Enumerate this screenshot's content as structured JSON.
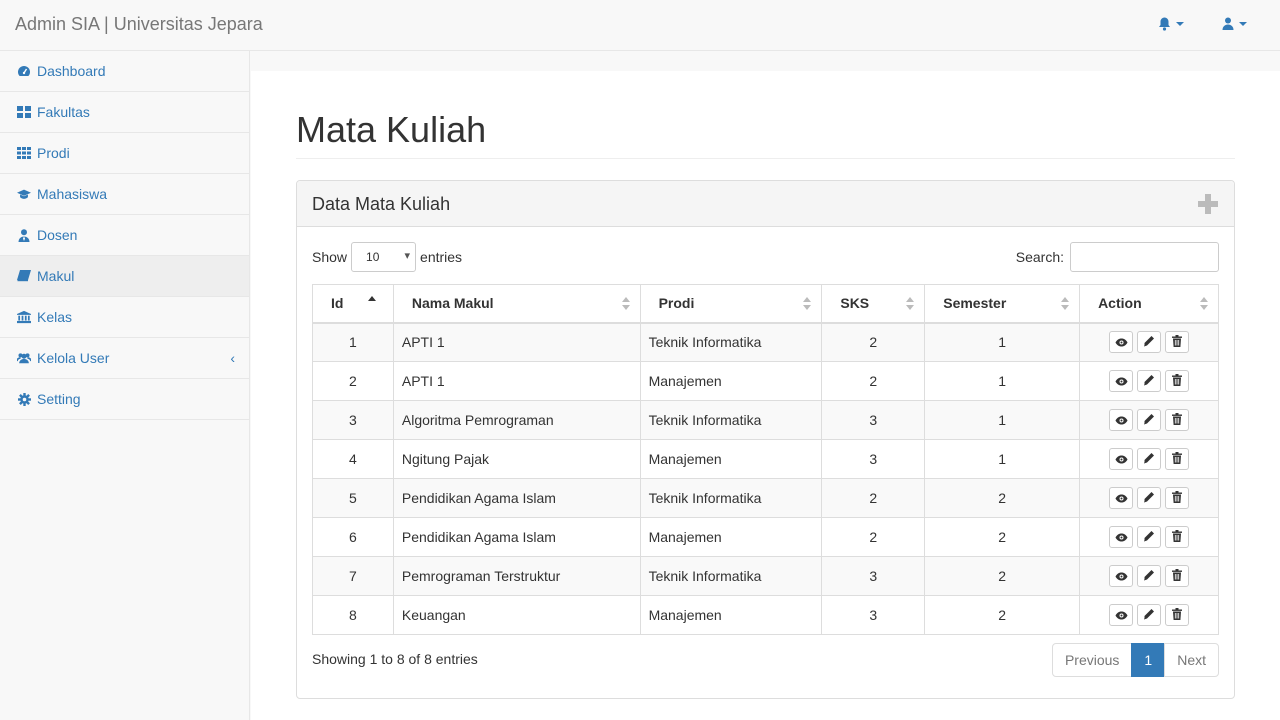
{
  "navbar": {
    "brand": "Admin SIA | Universitas Jepara",
    "icons": [
      "bell-icon",
      "user-icon"
    ]
  },
  "sidebar": {
    "items": [
      {
        "label": "Dashboard",
        "icon": "dashboard-icon"
      },
      {
        "label": "Fakultas",
        "icon": "th-large-icon"
      },
      {
        "label": "Prodi",
        "icon": "th-icon"
      },
      {
        "label": "Mahasiswa",
        "icon": "graduation-cap-icon"
      },
      {
        "label": "Dosen",
        "icon": "user-tie-icon"
      },
      {
        "label": "Makul",
        "icon": "book-icon",
        "active": true
      },
      {
        "label": "Kelas",
        "icon": "institution-icon"
      },
      {
        "label": "Kelola User",
        "icon": "users-icon"
      },
      {
        "label": "Setting",
        "icon": "gear-icon"
      }
    ]
  },
  "page": {
    "title": "Mata Kuliah"
  },
  "panel": {
    "title": "Data Mata Kuliah",
    "show_label": "Show",
    "page_length": "10",
    "entries_label": "entries",
    "search_label": "Search:",
    "search_value": ""
  },
  "table": {
    "headers": [
      "Id",
      "Nama Makul",
      "Prodi",
      "SKS",
      "Semester",
      "Action"
    ],
    "rows": [
      {
        "id": "1",
        "nama": "APTI 1",
        "prodi": "Teknik Informatika",
        "sks": "2",
        "semester": "1"
      },
      {
        "id": "2",
        "nama": "APTI 1",
        "prodi": "Manajemen",
        "sks": "2",
        "semester": "1"
      },
      {
        "id": "3",
        "nama": "Algoritma Pemrograman",
        "prodi": "Teknik Informatika",
        "sks": "3",
        "semester": "1"
      },
      {
        "id": "4",
        "nama": "Ngitung Pajak",
        "prodi": "Manajemen",
        "sks": "3",
        "semester": "1"
      },
      {
        "id": "5",
        "nama": "Pendidikan Agama Islam",
        "prodi": "Teknik Informatika",
        "sks": "2",
        "semester": "2"
      },
      {
        "id": "6",
        "nama": "Pendidikan Agama Islam",
        "prodi": "Manajemen",
        "sks": "2",
        "semester": "2"
      },
      {
        "id": "7",
        "nama": "Pemrograman Terstruktur",
        "prodi": "Teknik Informatika",
        "sks": "3",
        "semester": "2"
      },
      {
        "id": "8",
        "nama": "Keuangan",
        "prodi": "Manajemen",
        "sks": "3",
        "semester": "2"
      }
    ]
  },
  "footer": {
    "info": "Showing 1 to 8 of 8 entries",
    "prev": "Previous",
    "page": "1",
    "next": "Next"
  },
  "colors": {
    "link": "#337ab7",
    "active_page": "#337ab7"
  }
}
